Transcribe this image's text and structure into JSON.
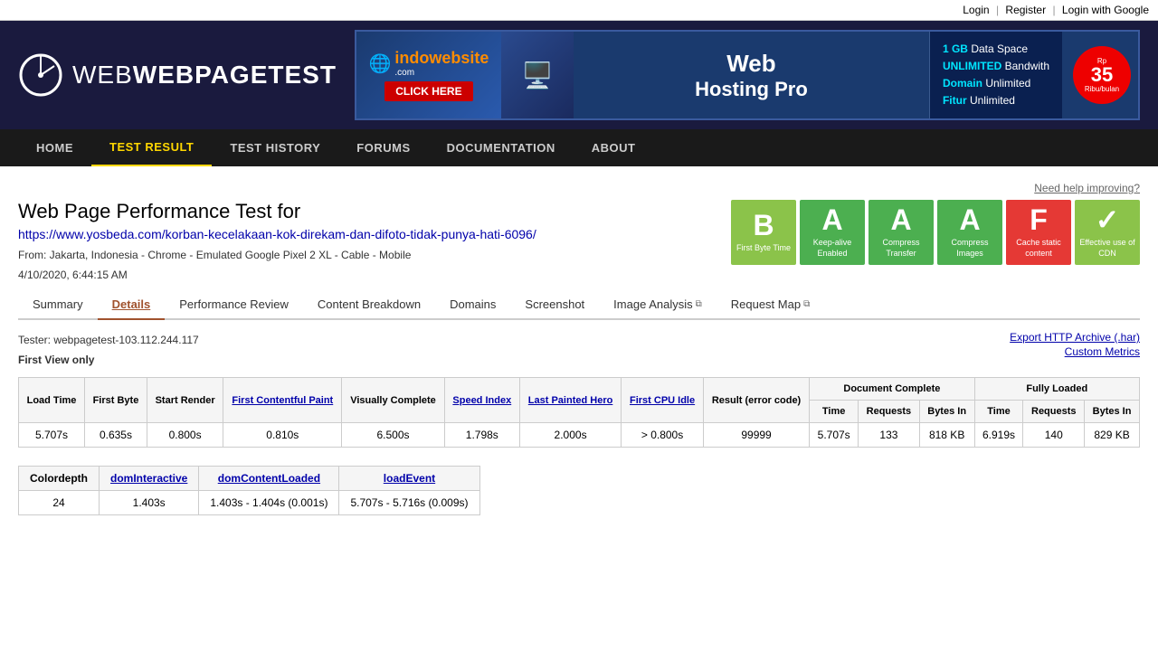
{
  "topbar": {
    "login_label": "Login",
    "separator1": "|",
    "register_label": "Register",
    "separator2": "|",
    "login_google_label": "Login with Google"
  },
  "header": {
    "logo_text": "WEBPAGETEST",
    "banner": {
      "brand": "indowebsite",
      "click_here": "CLICK HERE",
      "hosting_title": "Web",
      "hosting_subtitle": "Hosting Pro",
      "feature1_label": "1 GB",
      "feature1_value": "Data Space",
      "feature2_label": "UNLIMITED",
      "feature2_value": "Bandwith",
      "feature3_label": "Domain",
      "feature3_value": "Unlimited",
      "feature4_label": "Fitur",
      "feature4_value": "Unlimited",
      "price_num": "35",
      "price_label": "Ribu/bulan"
    }
  },
  "nav": {
    "items": [
      {
        "label": "HOME",
        "active": false
      },
      {
        "label": "TEST RESULT",
        "active": true
      },
      {
        "label": "TEST HISTORY",
        "active": false
      },
      {
        "label": "FORUMS",
        "active": false
      },
      {
        "label": "DOCUMENTATION",
        "active": false
      },
      {
        "label": "ABOUT",
        "active": false
      }
    ]
  },
  "main": {
    "need_help": "Need help improving?",
    "page_title": "Web Page Performance Test for",
    "test_url": "https://www.yosbeda.com/korban-kecelakaan-kok-direkam-dan-difoto-tidak-punya-hati-6096/",
    "from_line": "From: Jakarta, Indonesia - Chrome - Emulated Google Pixel 2 XL - Cable - Mobile",
    "date_line": "4/10/2020, 6:44:15 AM",
    "grades": [
      {
        "letter": "B",
        "label": "First Byte Time",
        "class": "grade-b"
      },
      {
        "letter": "A",
        "label": "Keep-alive Enabled",
        "class": "grade-a"
      },
      {
        "letter": "A",
        "label": "Compress Transfer",
        "class": "grade-a"
      },
      {
        "letter": "A",
        "label": "Compress Images",
        "class": "grade-a"
      },
      {
        "letter": "F",
        "label": "Cache static content",
        "class": "grade-f"
      },
      {
        "letter": "✓",
        "label": "Effective use of CDN",
        "class": "grade-check"
      }
    ],
    "tabs": [
      {
        "label": "Summary",
        "active": false,
        "ext": false
      },
      {
        "label": "Details",
        "active": true,
        "ext": false
      },
      {
        "label": "Performance Review",
        "active": false,
        "ext": false
      },
      {
        "label": "Content Breakdown",
        "active": false,
        "ext": false
      },
      {
        "label": "Domains",
        "active": false,
        "ext": false
      },
      {
        "label": "Screenshot",
        "active": false,
        "ext": false
      },
      {
        "label": "Image Analysis",
        "active": false,
        "ext": true
      },
      {
        "label": "Request Map",
        "active": false,
        "ext": true
      }
    ],
    "tester": "Tester: webpagetest-103.112.244.117",
    "view": "First View only",
    "export_label": "Export HTTP Archive (.har)",
    "custom_metrics_label": "Custom Metrics",
    "table": {
      "headers_row1": [
        {
          "label": "Load Time",
          "link": false
        },
        {
          "label": "First Byte",
          "link": false
        },
        {
          "label": "Start Render",
          "link": false
        },
        {
          "label": "First Contentful Paint",
          "link": true
        },
        {
          "label": "Visually Complete",
          "link": false
        },
        {
          "label": "Speed Index",
          "link": true
        },
        {
          "label": "Last Painted Hero",
          "link": true
        },
        {
          "label": "First CPU Idle",
          "link": true
        },
        {
          "label": "Result (error code)",
          "link": false
        },
        {
          "label": "Document Complete",
          "colspan": 3,
          "section": true
        },
        {
          "label": "Fully Loaded",
          "colspan": 3,
          "section": true
        }
      ],
      "headers_row2": [
        "Time",
        "Requests",
        "Bytes In",
        "Time",
        "Requests",
        "Bytes In"
      ],
      "data_row": {
        "load_time": "5.707s",
        "first_byte": "0.635s",
        "start_render": "0.800s",
        "first_contentful_paint": "0.810s",
        "visually_complete": "6.500s",
        "speed_index": "1.798s",
        "last_painted_hero": "2.000s",
        "first_cpu_idle": "> 0.800s",
        "result": "99999",
        "doc_time": "5.707s",
        "doc_requests": "133",
        "doc_bytes": "818 KB",
        "full_time": "6.919s",
        "full_requests": "140",
        "full_bytes": "829 KB"
      }
    },
    "metrics_table": {
      "headers": [
        "Colordepth",
        "domInteractive",
        "domContentLoaded",
        "loadEvent"
      ],
      "data": {
        "colordepth": "24",
        "dom_interactive": "1.403s",
        "dom_content_loaded": "1.403s - 1.404s (0.001s)",
        "load_event": "5.707s - 5.716s (0.009s)"
      }
    }
  }
}
